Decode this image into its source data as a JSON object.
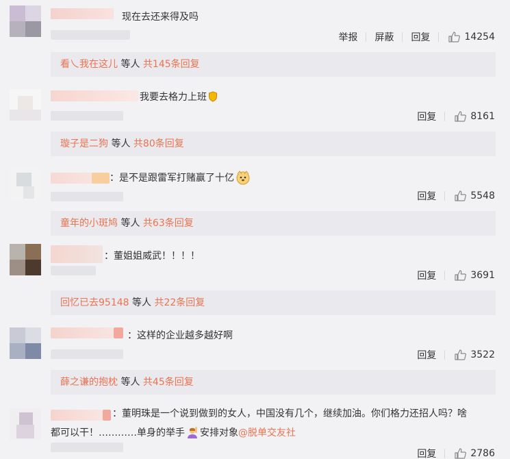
{
  "comments": [
    {
      "text": "现在去还来得及吗",
      "actions": [
        "举报",
        "屏蔽",
        "回复"
      ],
      "likes": "14254",
      "reply": {
        "who": "看乀我在这儿",
        "mid": " 等人 ",
        "count": "共145条回复"
      }
    },
    {
      "text": "我要去格力上班",
      "actions": [
        "回复"
      ],
      "likes": "8161",
      "reply": {
        "who": "璇子是二狗",
        "mid": " 等人 ",
        "count": "共80条回复"
      }
    },
    {
      "text": "：是不是跟雷军打赌赢了十亿",
      "actions": [
        "回复"
      ],
      "likes": "5548",
      "reply": {
        "who": "童年的小斑鸠",
        "mid": " 等人 ",
        "count": "共63条回复"
      }
    },
    {
      "text": "：董姐姐威武！！！！",
      "actions": [
        "回复"
      ],
      "likes": "3691",
      "reply": {
        "who": "回忆已去95148",
        "mid": " 等人 ",
        "count": "共22条回复"
      }
    },
    {
      "text": "：这样的企业越多越好啊",
      "actions": [
        "回复"
      ],
      "likes": "3522",
      "reply": {
        "who": "薛之谦的抱枕",
        "mid": " 等人 ",
        "count": "共45条回复"
      }
    },
    {
      "text_line1": "：董明珠是一个说到做到的女人，中国没有几个，继续加油。你们格力还招人吗？啥",
      "text_line2_a": "都可以干！…………单身的举手",
      "text_line2_b": "安排对象",
      "text_line2_link": "@脱单交友社",
      "actions": [
        "回复"
      ],
      "likes": "2786"
    }
  ],
  "icons": {
    "like": "thumbs-up-icon",
    "badge": "shield-badge-icon",
    "emoji_dog": "dog-face-emoji-icon",
    "emoji_hand": "person-raising-hand-emoji-icon"
  },
  "colors": {
    "accent": "#eb7350",
    "reply_bg": "#e9e9ee",
    "page_bg": "#f2f2f5"
  }
}
